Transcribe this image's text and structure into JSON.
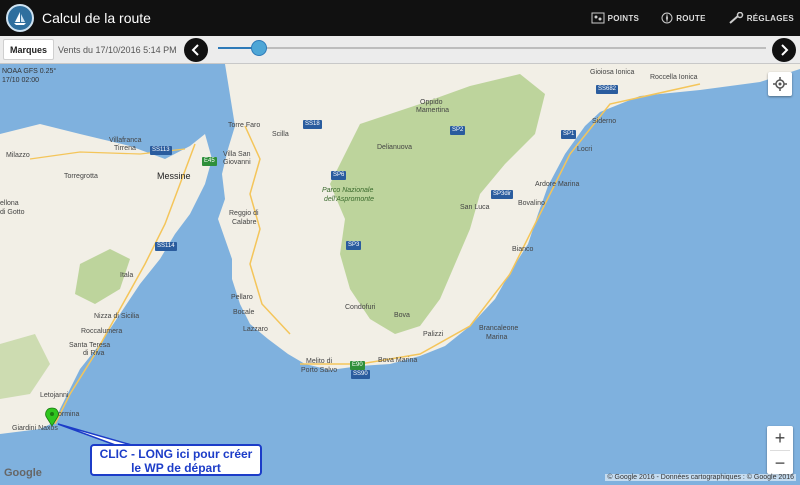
{
  "header": {
    "title": "Calcul de la route",
    "actions": [
      {
        "label": "POINTS",
        "icon": "map-points-icon"
      },
      {
        "label": "ROUTE",
        "icon": "compass-icon"
      },
      {
        "label": "RÉGLAGES",
        "icon": "wrench-icon"
      }
    ]
  },
  "toolbar": {
    "tab_label": "Marques",
    "wind_label": "Vents du 17/10/2016 5:14 PM",
    "slider_value_percent": 8
  },
  "map": {
    "model_line1": "NOAA GFS 0.25°",
    "model_line2": "17/10 02:00",
    "places": {
      "gioiosa_ionica": "Gioiosa Ionica",
      "roccella_ionica": "Roccella Ionica",
      "oppido_mamertina_1": "Oppido",
      "oppido_mamertina_2": "Mamertina",
      "siderno": "Siderno",
      "torre_faro": "Torre Faro",
      "scilla": "Scilla",
      "villafranca_1": "Villafranca",
      "villafranca_2": "Tirrena",
      "milazzo": "Milazzo",
      "delianuova": "Delianuova",
      "locri": "Locri",
      "villa_sg_1": "Villa San",
      "villa_sg_2": "Giovanni",
      "torregrotta": "Torregrotta",
      "messine": "Messine",
      "ardore_marina": "Ardore Marina",
      "parco_1": "Parco Nazionale",
      "parco_2": "dell'Aspromonte",
      "bovalino": "Bovalino",
      "barcellona_1": "ellona",
      "barcellona_2": "di Gotto",
      "san_luca": "San Luca",
      "reggio_1": "Reggio di",
      "reggio_2": "Calabre",
      "bianco": "Bianco",
      "itala": "Itala",
      "pellaro": "Pellaro",
      "nizza_1": "Nizza di Sicilia",
      "bocale": "Bocale",
      "condofuri": "Condofuri",
      "bova": "Bova",
      "lazzaro": "Lazzaro",
      "roccalumera": "Roccalumera",
      "brancaleone_1": "Brancaleone",
      "brancaleone_2": "Marina",
      "palizzi": "Palizzi",
      "santa_teresa_1": "Santa Teresa",
      "santa_teresa_2": "di Riva",
      "melito_1": "Melito di",
      "melito_2": "Porto Salvo",
      "bova_marina": "Bova Marina",
      "letojanni": "Letojanni",
      "taormina": "ormina",
      "giardini": "Giardini Naxos"
    },
    "shields": {
      "ss682": "SS682",
      "ss18": "SS18",
      "sp2": "SP2",
      "sp1": "SP1",
      "ss113": "SS113",
      "e45": "E45",
      "sp6": "SP6",
      "sp3dir": "SP3dir",
      "ss114": "SS114",
      "sp3": "SP3",
      "e90": "E90",
      "ss90": "SS90"
    },
    "google_logo": "Google",
    "copyright": "© Google 2016 - Données cartographiques : © Google 2016",
    "zoom_in": "+",
    "zoom_out": "−"
  },
  "callout": {
    "line1": "CLIC - LONG ici pour créer",
    "line2": "le WP de départ"
  },
  "colors": {
    "sea": "#7fb1de",
    "land": "#f2efe6",
    "park": "#b4cf8e",
    "callout_border": "#1c3cc8",
    "marker": "#2fc61e"
  }
}
